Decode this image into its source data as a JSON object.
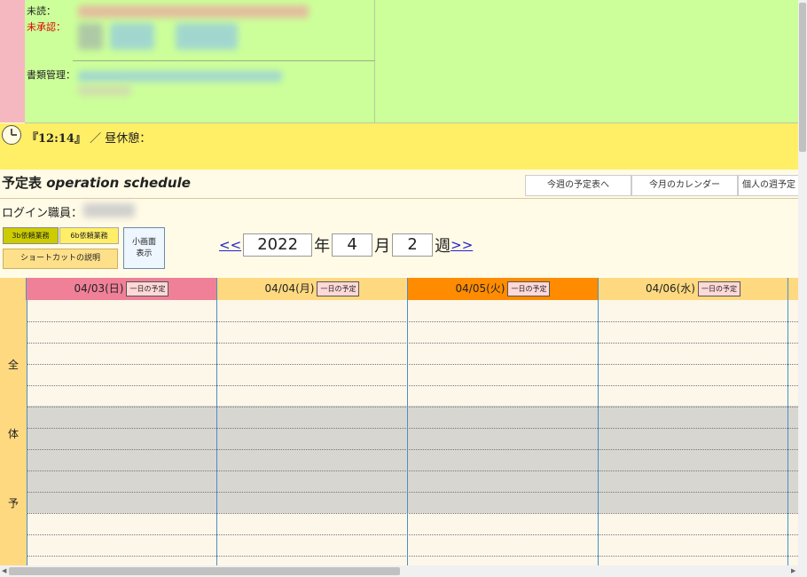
{
  "notify": {
    "unread_label": "未読：",
    "unapproved_label": "未承認：",
    "document_label": "書類管理："
  },
  "clock": {
    "time": "『12:14』",
    "break_text": "／ 昼休憩："
  },
  "header": {
    "title_ja": "予定表",
    "title_en": "operation schedule",
    "nav": [
      "今週の予定表へ",
      "今月のカレンダー",
      "個人の週予定"
    ]
  },
  "login": {
    "label": "ログイン職員："
  },
  "buttons": {
    "req3b": "3b依頼業務",
    "req6b": "6b依頼業務",
    "shortcut": "ショートカットの説明",
    "small_screen": "小画面\n表示"
  },
  "week": {
    "prev": "<<",
    "year": "2022",
    "year_unit": "年",
    "month": "4",
    "month_unit": "月",
    "week": "2",
    "week_unit": "週",
    "next": ">>"
  },
  "calendar": {
    "days": [
      {
        "date": "04/03(日)",
        "btn": "一日の予定",
        "color": "#f08098",
        "text_color": "#222"
      },
      {
        "date": "04/04(月)",
        "btn": "一日の予定",
        "color": "#ffd980",
        "text_color": "#222"
      },
      {
        "date": "04/05(火)",
        "btn": "一日の予定",
        "color": "#ff8c00",
        "text_color": "#222"
      },
      {
        "date": "04/06(水)",
        "btn": "一日の予定",
        "color": "#ffd980",
        "text_color": "#222"
      }
    ],
    "side_chars": [
      "全",
      "体",
      "予"
    ]
  }
}
